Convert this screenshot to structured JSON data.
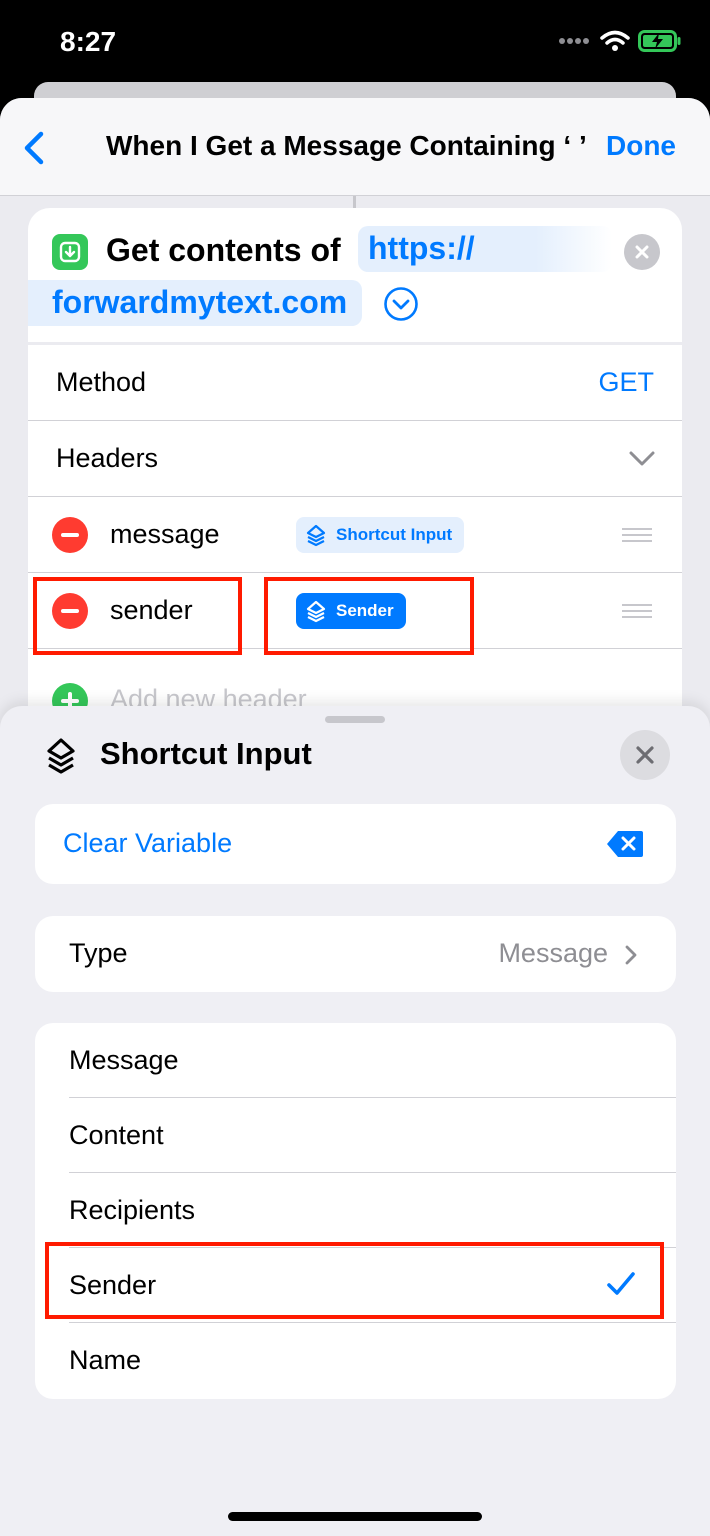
{
  "status": {
    "time": "8:27"
  },
  "nav": {
    "title": "When I Get a Message Containing ‘ ’",
    "done": "Done"
  },
  "action": {
    "label": "Get contents of",
    "url_part1": "https://",
    "url_part2": "forwardmytext.com",
    "method_label": "Method",
    "method_value": "GET",
    "headers_label": "Headers",
    "headers": [
      {
        "key": "message",
        "value": "Shortcut Input"
      },
      {
        "key": "sender",
        "value": "Sender"
      }
    ],
    "add_header": "Add new header"
  },
  "sheet": {
    "title": "Shortcut Input",
    "clear_variable": "Clear Variable",
    "type_label": "Type",
    "type_value": "Message",
    "options": [
      "Message",
      "Content",
      "Recipients",
      "Sender",
      "Name"
    ],
    "selected_option": "Sender"
  },
  "colors": {
    "accent": "#007aff",
    "highlight": "#ff1a00",
    "minus": "#ff3b30",
    "plus": "#34c759"
  },
  "icons": [
    "back-chevron-icon",
    "get-contents-icon",
    "clear-icon",
    "expand-icon",
    "chevron-down-icon",
    "shortcut-input-icon",
    "close-icon",
    "delete-backward-icon",
    "chevron-right-icon",
    "checkmark-icon",
    "drag-handle-icon",
    "wifi-icon",
    "battery-icon",
    "signal-icon"
  ]
}
